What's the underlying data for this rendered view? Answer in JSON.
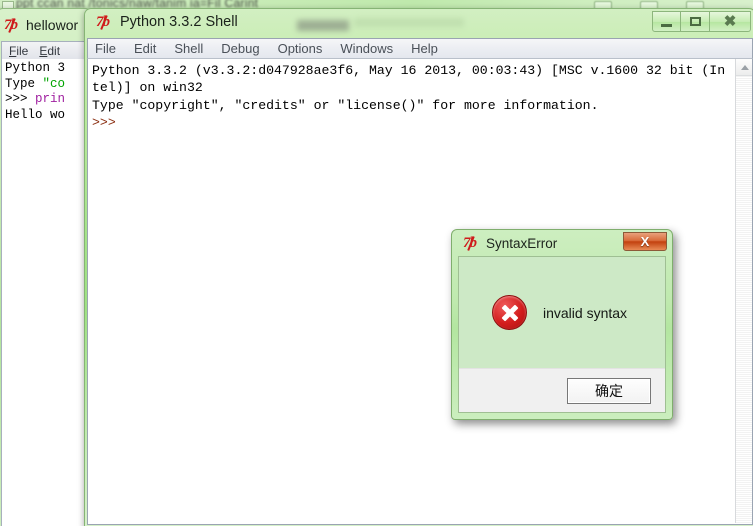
{
  "background_strip": {
    "blurred_text": "ppt ccan nat /tonics/naw/tanim  ia=Fil  Carint",
    "note": "partially visible background window behind the IDLE windows"
  },
  "editor_window": {
    "title": "hellowor",
    "icon": "python-icon",
    "menu": [
      {
        "label": "File",
        "accel": "F"
      },
      {
        "label": "Edit",
        "accel": "E"
      }
    ],
    "content_lines": [
      {
        "text": "Python 3",
        "color": "#000000"
      },
      {
        "prefix": "Type ",
        "quoted": "\"co",
        "color": "#00a400"
      },
      {
        "prefix": ">>> ",
        "code": "prin",
        "color": "#a020a0"
      },
      {
        "text": "Hello wo",
        "color": "#000000"
      }
    ]
  },
  "shell_window": {
    "title": "Python 3.3.2 Shell",
    "icon": "python-icon",
    "menu": [
      "File",
      "Edit",
      "Shell",
      "Debug",
      "Options",
      "Windows",
      "Help"
    ],
    "window_controls": {
      "minimize": "minimize-icon",
      "maximize": "maximize-icon",
      "close": "close-icon"
    },
    "console_lines": [
      "Python 3.3.2 (v3.3.2:d047928ae3f6, May 16 2013, 00:03:43) [MSC v.1600 32 bit (In",
      "tel)] on win32",
      "Type \"copyright\", \"credits\" or \"license()\" for more information."
    ],
    "prompt": ">>>",
    "scrollbar": {
      "up_arrow": "scroll-up-icon"
    }
  },
  "dialog": {
    "title": "SyntaxError",
    "icon": "python-icon",
    "close_label": "X",
    "error_icon": "error-x-icon",
    "message": "invalid syntax",
    "ok_button": "确定"
  },
  "colors": {
    "aero_green": "#a5e389",
    "dialog_body_green": "#cde9c6",
    "error_red": "#d31d1d",
    "close_orange": "#c2410f",
    "prompt_brown": "#8b2f12",
    "string_green": "#00a400",
    "keyword_purple": "#a020a0"
  }
}
